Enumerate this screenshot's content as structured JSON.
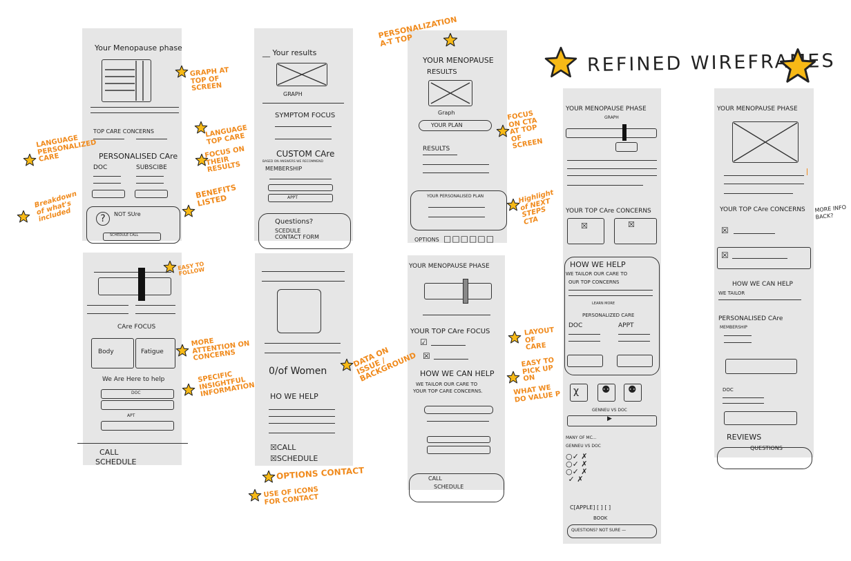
{
  "title": "REFINED WIREFRAMES",
  "colors": {
    "accent": "#f08a1c",
    "star": "#f7b916",
    "panel": "#e6e6e6",
    "ink": "#222222"
  },
  "panels": {
    "p1": {
      "title": "Your Menopause phase",
      "concerns": "TOP CARE CONCERNS",
      "personalised": "PERSONALISED CAre",
      "doc": "DOC",
      "subscribe": "SUBSCIBE",
      "not_sure": "NOT SUre",
      "schedule_call": "SCHEDULE CALL"
    },
    "p2": {
      "results": "__ Your results",
      "graph": "GRAPH",
      "symptom": "SYMPTOM FOCUS",
      "custom": "CUSTOM CAre",
      "small": "BASED ON ANSWERS WE RECOMMEND",
      "membership": "MEMBERSHIP",
      "appt": "APPT",
      "questions": "Questions?",
      "schedule": "SCEDULE",
      "contact": "CONTACT FORM"
    },
    "p3": {
      "title1": "YOUR MENOPAUSE",
      "title2": "RESULTS",
      "graph": "Graph",
      "plan": "YOUR PLAN",
      "results": "RESULTS",
      "personalised_plan": "YOUR PERSONALISED PLAN",
      "options": "OPTIONS"
    },
    "p4": {
      "care_focus": "CAre FOCUS",
      "body": "Body",
      "fatigue": "Fatigue",
      "here_help": "We Are Here to help",
      "doc": "DOC",
      "apt": "APT",
      "call": "CALL",
      "schedule": "SCHEDULE"
    },
    "p5": {
      "women": "0/of Women",
      "how": "HO WE HELP",
      "call": "CALL",
      "schedule": "SCHEDULE"
    },
    "p6": {
      "title": "YOUR MENOPAUSE PHASE",
      "focus": "YOUR TOP CAre FOCUS",
      "how": "HOW WE CAN HELP",
      "tailor": "WE TAILOR OUR CARE TO",
      "tailor2": "YOUR TOP CARE CONCERNS.",
      "call": "CALL",
      "schedule": "SCHEDULE"
    },
    "p7": {
      "title": "YOUR MENOPAUSE PHASE",
      "graph": "GRAPH",
      "concerns": "YOUR TOP CAre CONCERNS",
      "how": "HOW WE HELP",
      "tailor": "WE TAILOR OUR CARE TO",
      "tailor2": "OUR TOP CONCERNS",
      "learn": "LEARN MORE",
      "personalized": "PERSONALIZED CARE",
      "doc": "DOC",
      "appt": "APPT",
      "genneu": "GENNEU VS DOC",
      "many": "MANY OF MC...",
      "genneu2": "GENNEU VS DOC",
      "apple": "C[APPLE] [ ] [ ]",
      "book": "BOOK",
      "questions": "QUESTIONS? NOT SURE —"
    },
    "p8": {
      "title": "YOUR MENOPAUSE PHASE",
      "concerns": "YOUR TOP CAre CONCERNS",
      "how": "HOW WE CAN HELP",
      "tailor": "WE TAILOR",
      "personalised": "PERSONALISED CAre",
      "membership": "MEMBERSHIP",
      "doc": "DOC",
      "reviews": "REVIEWS",
      "questions": "QUESTIONS"
    }
  },
  "notes": {
    "personalization": "PERSONALIZATION A-T TOP",
    "graph": "GRAPH AT TOP OF SCREEN",
    "language": "LANGUAGE TOP CARE",
    "focus": "FOCUS ON THEIR RESULTS",
    "benefits": "BENEFITS LISTED",
    "lang_personal": "LANGUAGE PERSONALIZED CARE",
    "breakdown": "Breakdown of what's included",
    "focus_cta": "FOCUS ON CTA AT TOP OF SCREEN",
    "highlight": "Highlight of NEXT STEPS CTA",
    "easy": "EASY TO FOLLOW",
    "more_attention": "MORE ATTENTION ON CONCERNS",
    "specific": "SPECIFIC INSIGHTFUL INFORMATION",
    "data": "DATA ON ISSUE / BACKGROUND",
    "layout": "LAYOUT OF CARE",
    "easy_pick": "EASY TO PICK UP ON",
    "what_we_do": "WHAT WE DO VALUE P",
    "options_contact": "OPTIONS CONTACT",
    "icons": "USE OF ICONS FOR CONTACT",
    "more_info": "MORE INFO BACK?"
  }
}
